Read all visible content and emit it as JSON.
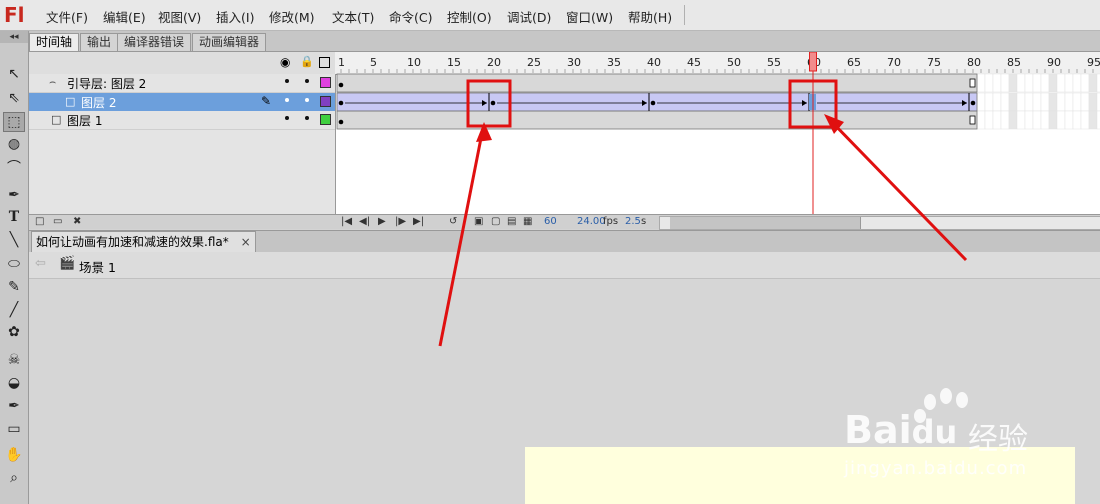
{
  "app": {
    "logo": "Fl"
  },
  "menu": [
    "文件(F)",
    "编辑(E)",
    "视图(V)",
    "插入(I)",
    "修改(M)",
    "文本(T)",
    "命令(C)",
    "控制(O)",
    "调试(D)",
    "窗口(W)",
    "帮助(H)"
  ],
  "toolbar_icons": [
    "selection-icon",
    "subselection-icon",
    "free-transform-icon",
    "3d-rotation-icon",
    "lasso-icon",
    "pen-icon",
    "text-icon",
    "line-icon",
    "oval-icon",
    "pencil-icon",
    "brush-icon",
    "deco-icon",
    "bone-icon",
    "paint-bucket-icon",
    "eyedropper-icon",
    "eraser-icon",
    "hand-icon",
    "zoom-icon"
  ],
  "timeline": {
    "tabs": [
      "时间轴",
      "输出",
      "编译器错误",
      "动画编辑器"
    ],
    "ruler_labels": [
      "1",
      "5",
      "10",
      "15",
      "20",
      "25",
      "30",
      "35",
      "40",
      "45",
      "50",
      "55",
      "60",
      "65",
      "70",
      "75",
      "80",
      "85",
      "90",
      "95"
    ],
    "current_frame": 60,
    "layers": [
      {
        "name": "引导层: 图层 2",
        "type": "guide",
        "color": "#e040e0",
        "selected": false
      },
      {
        "name": "图层 2",
        "type": "guided",
        "color": "#8040c0",
        "selected": true
      },
      {
        "name": "图层 1",
        "type": "normal",
        "color": "#40d040",
        "selected": false
      }
    ],
    "status": {
      "frame": "60",
      "fps": "24.00",
      "fps_unit": "fps",
      "time": "2.5",
      "time_unit": "s"
    }
  },
  "document": {
    "tab_title": "如何让动画有加速和减速的效果.fla*",
    "tab_close": "×",
    "scene": "场景 1"
  },
  "colors": {
    "annotation": "#e01010",
    "selection": "#6c9fdc",
    "tween": "#c8c8f4",
    "playhead": "#e02020",
    "canvas": "#ffffdd"
  },
  "watermark": {
    "brand": "Bai",
    "brand_suffix": "du",
    "product": "经验",
    "url": "jingyan.baidu.com"
  }
}
